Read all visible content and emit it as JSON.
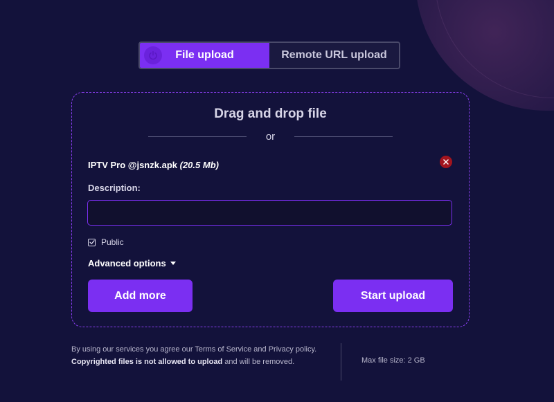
{
  "colors": {
    "background": "#13123b",
    "accent": "#7b2ff2",
    "remove": "#a2141e"
  },
  "tabs": [
    {
      "label": "File upload",
      "icon": "power-icon",
      "active": true
    },
    {
      "label": "Remote URL upload",
      "active": false
    }
  ],
  "dropzone": {
    "title": "Drag and drop file",
    "or_text": "or"
  },
  "file": {
    "name": "IPTV Pro @jsnzk.apk",
    "size": "(20.5 Mb)",
    "remove_icon": "close-icon"
  },
  "description": {
    "label": "Description:",
    "value": ""
  },
  "public": {
    "label": "Public",
    "checked": true
  },
  "advanced": {
    "label": "Advanced options"
  },
  "buttons": {
    "add_more": "Add more",
    "start_upload": "Start upload"
  },
  "footer": {
    "terms_prefix": "By using our services you agree our Terms of Service and Privacy policy.",
    "copyright_bold": "Copyrighted files is not allowed to upload",
    "terms_suffix": "and will be removed.",
    "max_size": "Max file size: 2 GB"
  }
}
